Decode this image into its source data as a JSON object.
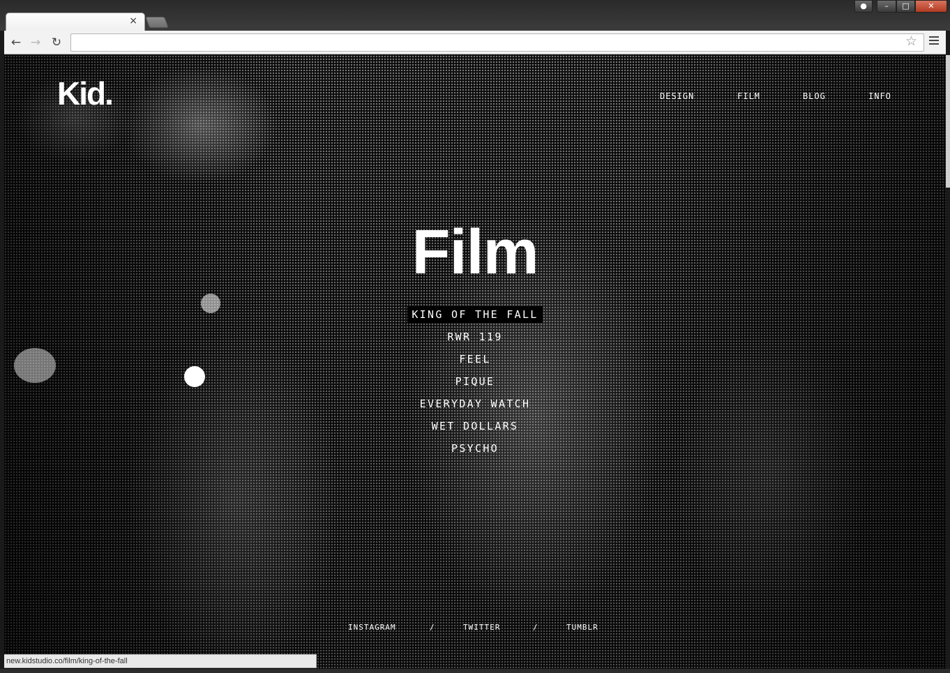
{
  "browser": {
    "tab_close_glyph": "×",
    "address": "",
    "icons": {
      "back": "arrow-left-icon",
      "forward": "arrow-right-icon",
      "reload": "reload-icon",
      "bookmark": "star-icon",
      "menu": "hamburger-menu-icon"
    },
    "status_url": "new.kidstudio.co/film/king-of-the-fall"
  },
  "site": {
    "logo": "Kid.",
    "nav": [
      "DESIGN",
      "FILM",
      "BLOG",
      "INFO"
    ],
    "title": "Film",
    "films": [
      "KING OF THE FALL",
      "RWR 119",
      "FEEL",
      "PIQUE",
      "EVERYDAY WATCH",
      "WET DOLLARS",
      "PSYCHO"
    ],
    "hovered_film": "KING OF THE FALL",
    "social": [
      "INSTAGRAM",
      "/",
      "TWITTER",
      "/",
      "TUMBLR"
    ]
  },
  "colors": {
    "text": "#ffffff",
    "background": "#0c0c0c",
    "highlight": "#000000"
  }
}
